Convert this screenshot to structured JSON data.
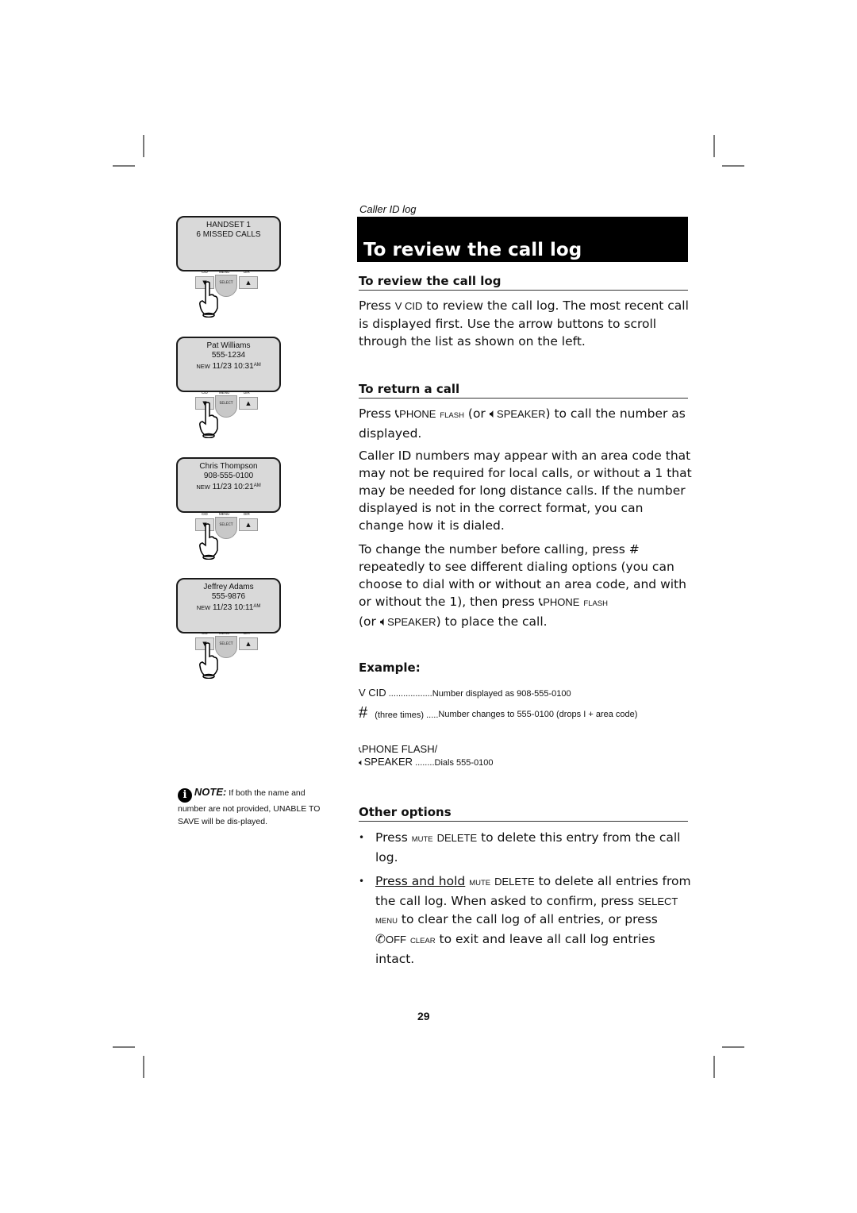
{
  "header": {
    "section_label": "Caller ID log",
    "banner_title": "To review the call log"
  },
  "handset_screens": [
    {
      "line1": "HANDSET 1",
      "line2": "6 MISSED CALLS",
      "line3": ""
    },
    {
      "line1": "Pat Williams",
      "line2": "555-1234",
      "new": "NEW",
      "date": "11/23 10:31",
      "ampm": "AM"
    },
    {
      "line1": "Chris Thompson",
      "line2": "908-555-0100",
      "new": "NEW",
      "date": "11/23 10:21",
      "ampm": "AM"
    },
    {
      "line1": "Jeffrey Adams",
      "line2": "555-9876",
      "new": "NEW",
      "date": "11/23 10:11",
      "ampm": "AM"
    }
  ],
  "keypad": {
    "cid": "CID",
    "menu": "MENU",
    "dir": "DIR",
    "select": "SELECT"
  },
  "note": {
    "title": "NOTE:",
    "text": " If both the name and number are not provided, UNABLE TO SAVE will be dis-played."
  },
  "review": {
    "heading": "To review the call log",
    "p1a": "Press ",
    "p1key": "V CID",
    "p1b": " to review the call log.  The most recent call is displayed first. Use the arrow buttons to scroll through the list as shown on the left."
  },
  "return_call": {
    "heading": "To return a call",
    "p1a": "Press ",
    "phone": "PHONE",
    "flash": "FLASH",
    "p1b": " (or ",
    "speaker": "SPEAKER",
    "p1c": ") to call the number as displayed.",
    "p2": "Caller ID numbers may appear with an area code that may not be required for local calls, or without a 1 that may be needed for long distance calls. If the number displayed is not in the correct format, you can change how it is dialed.",
    "p3a": "To change the number before calling, press # repeatedly to see different dialing options (you can choose to dial with or without an area code, and with or without the 1), then press ",
    "p3b": " (or ",
    "p3c": ") to place the call."
  },
  "example": {
    "heading": "Example:",
    "rows": [
      {
        "key": "V CID",
        "dots": " ..................",
        "result": "Number displayed as 908-555-0100"
      },
      {
        "key": "#",
        "note": "(three times)",
        "dots": " .....",
        "result": "Number changes to 555-0100 (drops I + area code)"
      },
      {
        "key": "PHONE FLASH/",
        "key2": "SPEAKER",
        "dots": " ........",
        "result": "Dials 555-0100"
      }
    ]
  },
  "other_options": {
    "heading": "Other options",
    "b1a": "Press ",
    "mute": "MUTE",
    "delete": "DELETE",
    "b1b": " to delete this entry from the call log.",
    "b2u": "Press and hold",
    "b2b": " to delete all entries from the call log.  When asked to confirm, press ",
    "select": "SELECT",
    "menu": "MENU",
    "b2c": " to clear the call log of all entries, or press ",
    "off": "OFF",
    "clear": "CLEAR",
    "b2d": " to exit and leave all call log entries intact."
  },
  "footer": {
    "page_number": "29"
  }
}
